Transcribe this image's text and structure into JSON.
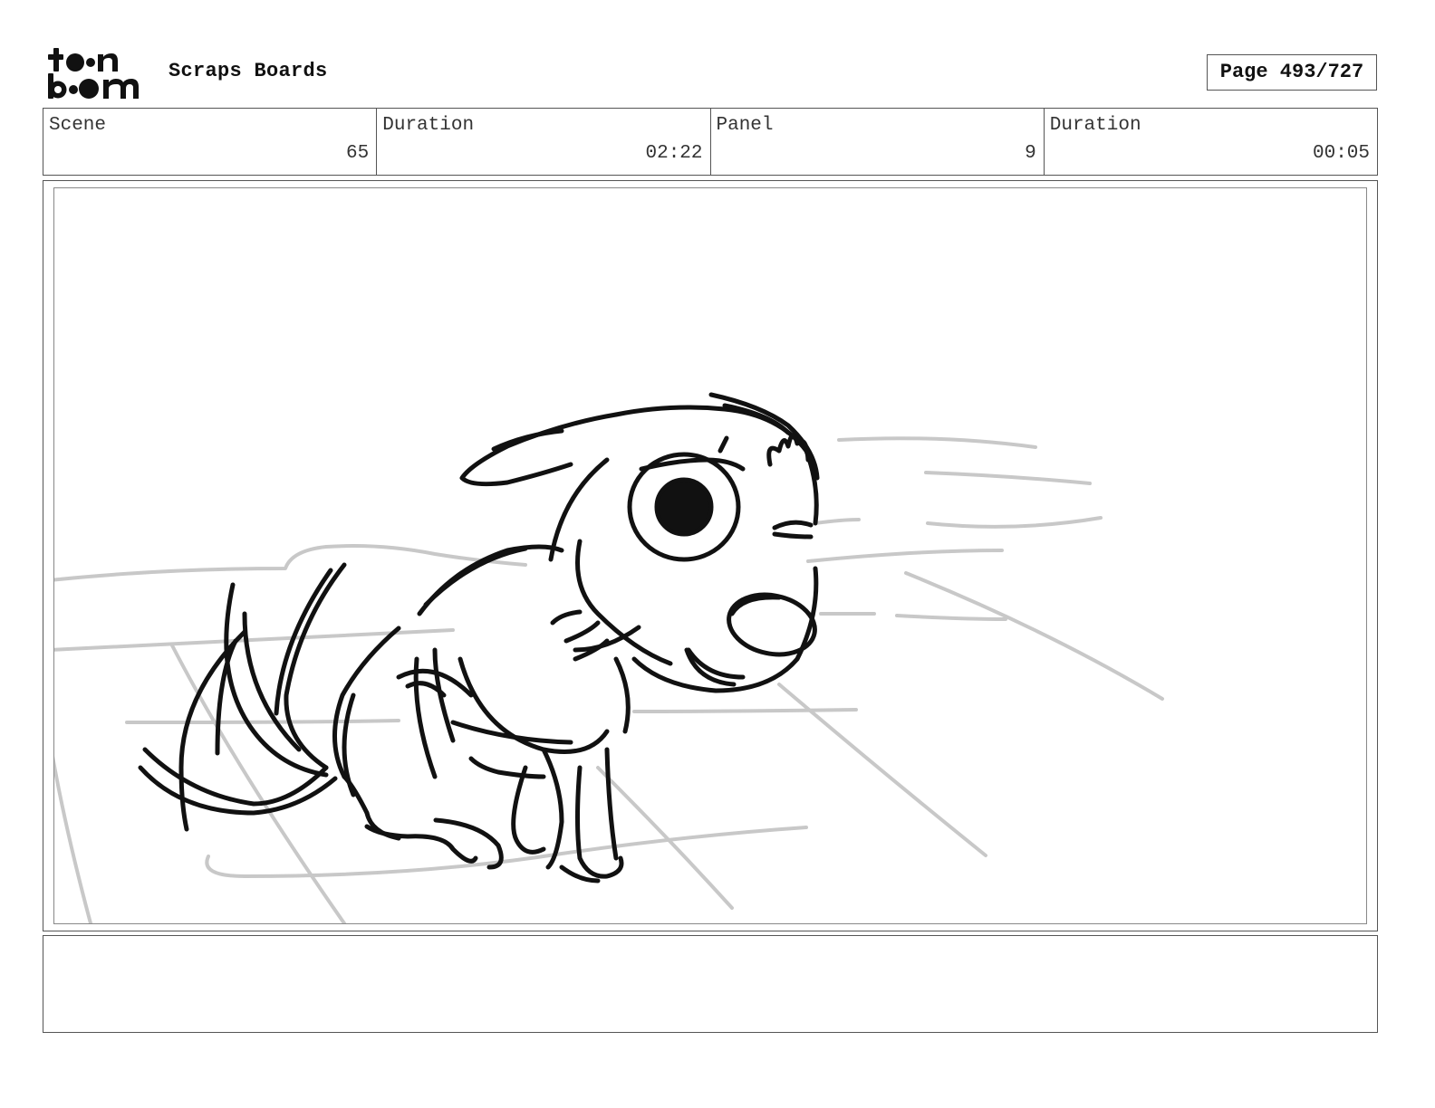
{
  "header": {
    "logo": "toon boom",
    "project_title": "Scraps Boards",
    "page_label": "Page 493/727"
  },
  "info": [
    {
      "label": "Scene",
      "value": "65"
    },
    {
      "label": "Duration",
      "value": "02:22"
    },
    {
      "label": "Panel",
      "value": "9"
    },
    {
      "label": "Duration",
      "value": "00:05"
    }
  ],
  "panel": {
    "image": "storyboard sketch of a startled dog crouching on a tiled floor with speed lines"
  },
  "notes": {
    "text": ""
  }
}
